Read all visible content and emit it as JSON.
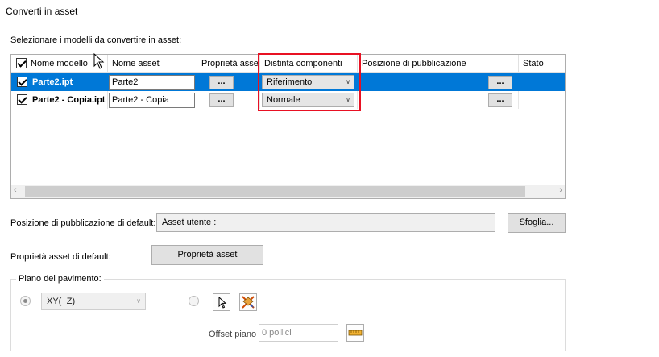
{
  "dialog": {
    "title": "Converti in asset",
    "instruction": "Selezionare i modelli da convertire in asset:"
  },
  "grid": {
    "columns": [
      "Nome modello",
      "Nome asset",
      "Proprietà asset",
      "Distinta componenti",
      "Posizione di pubblicazione",
      "Stato"
    ],
    "browse_label": "...",
    "rows": [
      {
        "checked": true,
        "model": "Parte2.ipt",
        "asset": "Parte2",
        "bom": "Riferimento",
        "selected": true
      },
      {
        "checked": true,
        "model": "Parte2 - Copia.ipt",
        "asset": "Parte2 - Copia",
        "bom": "Normale",
        "selected": false
      }
    ],
    "scroll_left": "‹",
    "scroll_right": "›"
  },
  "publish": {
    "label": "Posizione di pubblicazione di default:",
    "value": "Asset utente :",
    "browse_button": "Sfoglia..."
  },
  "asset_props": {
    "label": "Proprietà asset di default:",
    "button": "Proprietà asset"
  },
  "floor": {
    "group_label": "Piano del pavimento:",
    "plane_value": "XY(+Z)",
    "offset_label": "Offset piano",
    "offset_placeholder": "0 pollici"
  },
  "colors": {
    "selection": "#0078d7",
    "highlight_box": "#e81123"
  }
}
